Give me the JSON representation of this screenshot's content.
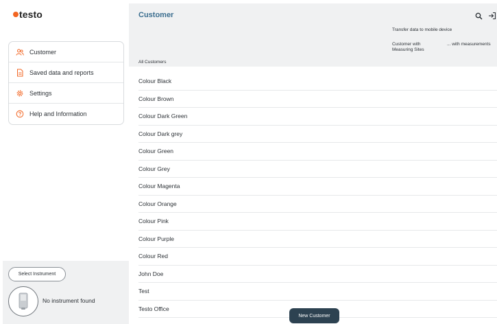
{
  "brand": {
    "logo_text": "testo",
    "accent": "#f26522",
    "primary": "#2d4251",
    "title_color": "#3b6e8f"
  },
  "sidebar": {
    "items": [
      {
        "label": "Customer",
        "icon": "users-icon"
      },
      {
        "label": "Saved data and reports",
        "icon": "document-icon"
      },
      {
        "label": "Settings",
        "icon": "gear-icon"
      },
      {
        "label": "Help and Information",
        "icon": "help-icon"
      }
    ]
  },
  "instrument": {
    "select_label": "Select Instrument",
    "status": "No instrument found"
  },
  "header": {
    "title": "Customer",
    "transfer_label": "Transfer data to mobile device",
    "col_measuring_sites": "Customer with Measuring Sites",
    "col_measurements": "... with measurements",
    "section_label": "All Customers"
  },
  "customers": [
    "Colour Black",
    "Colour Brown",
    "Colour Dark Green",
    "Colour Dark grey",
    "Colour Green",
    "Colour Grey",
    "Colour Magenta",
    "Colour Orange",
    "Colour Pink",
    "Colour Purple",
    "Colour Red",
    "John Doe",
    "Test",
    "Testo Office"
  ],
  "actions": {
    "new_customer": "New Customer"
  }
}
